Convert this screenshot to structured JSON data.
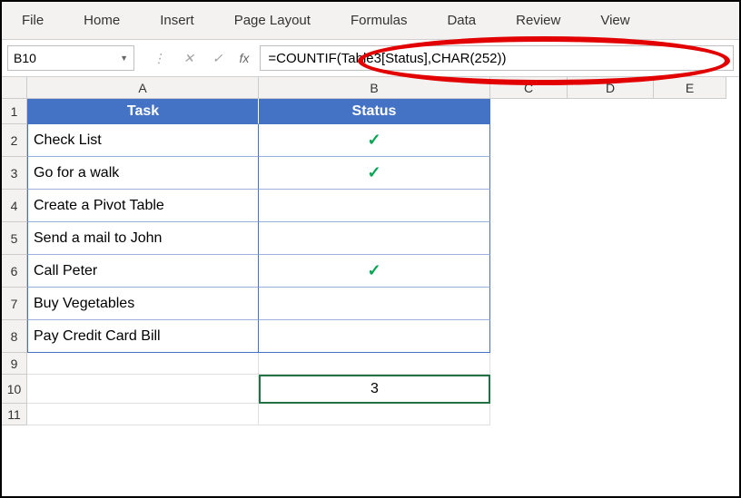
{
  "ribbon": {
    "tabs": [
      "File",
      "Home",
      "Insert",
      "Page Layout",
      "Formulas",
      "Data",
      "Review",
      "View"
    ]
  },
  "namebox": {
    "value": "B10"
  },
  "formula": {
    "value": "=COUNTIF(Table3[Status],CHAR(252))"
  },
  "columns": [
    "A",
    "B",
    "C",
    "D",
    "E"
  ],
  "rowCount": 11,
  "table": {
    "headers": {
      "task": "Task",
      "status": "Status"
    },
    "rows": [
      {
        "task": "Check List",
        "status": "✓"
      },
      {
        "task": "Go for a walk",
        "status": "✓"
      },
      {
        "task": "Create a Pivot Table",
        "status": ""
      },
      {
        "task": "Send a mail to John",
        "status": ""
      },
      {
        "task": "Call Peter",
        "status": "✓"
      },
      {
        "task": "Buy Vegetables",
        "status": ""
      },
      {
        "task": "Pay Credit Card Bill",
        "status": ""
      }
    ]
  },
  "result": {
    "value": "3"
  },
  "chart_data": {
    "type": "table",
    "title": "Task Status",
    "columns": [
      "Task",
      "Status"
    ],
    "rows": [
      [
        "Check List",
        "checked"
      ],
      [
        "Go for a walk",
        "checked"
      ],
      [
        "Create a Pivot Table",
        ""
      ],
      [
        "Send a mail to John",
        ""
      ],
      [
        "Call Peter",
        "checked"
      ],
      [
        "Buy Vegetables",
        ""
      ],
      [
        "Pay Credit Card Bill",
        ""
      ]
    ],
    "countif_result": 3
  },
  "layout": {
    "colWidths": {
      "A": 255,
      "B": 255,
      "C": 85,
      "D": 95,
      "E": 80
    },
    "rowHeights": {
      "header": 28,
      "data": 36,
      "small": 24
    }
  }
}
